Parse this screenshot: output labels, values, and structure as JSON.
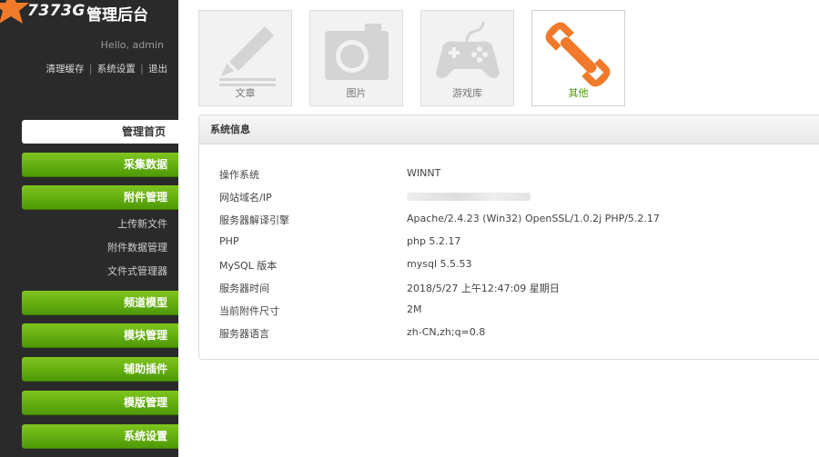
{
  "brand": {
    "name": "7373G",
    "subtitle": "管理后台"
  },
  "greeting": "Hello, admin",
  "toplinks": {
    "clear_cache": "清理缓存",
    "settings": "系统设置",
    "logout": "退出",
    "separator": "|"
  },
  "menu": {
    "home": "管理首页",
    "collect": "采集数据",
    "attachments": "附件管理",
    "attachment_items": [
      "上传新文件",
      "附件数据管理",
      "文件式管理器"
    ],
    "channel": "频道模型",
    "module": "模块管理",
    "plugin": "辅助插件",
    "template": "模版管理",
    "system": "系统设置"
  },
  "tiles": [
    {
      "label": "文章",
      "icon": "pencil-icon"
    },
    {
      "label": "图片",
      "icon": "camera-icon"
    },
    {
      "label": "游戏库",
      "icon": "gamepad-icon"
    },
    {
      "label": "其他",
      "icon": "wrench-icon"
    }
  ],
  "system_info": {
    "title": "系统信息",
    "rows": [
      {
        "key": "操作系统",
        "value": "WINNT"
      },
      {
        "key": "网站域名/IP",
        "value": ""
      },
      {
        "key": "服务器解译引擎",
        "value": "Apache/2.4.23 (Win32) OpenSSL/1.0.2j PHP/5.2.17"
      },
      {
        "key": "PHP",
        "value": "php 5.2.17"
      },
      {
        "key": "MySQL 版本",
        "value": "mysql 5.5.53"
      },
      {
        "key": "服务器时间",
        "value": "2018/5/27 上午12:47:09 星期日"
      },
      {
        "key": "当前附件尺寸",
        "value": "2M"
      },
      {
        "key": "服务器语言",
        "value": "zh-CN,zh;q=0.8"
      }
    ]
  },
  "colors": {
    "sidebar": "#2a2a2a",
    "accent_green": "#5aa80e",
    "wrench_orange": "#f07a2a"
  }
}
